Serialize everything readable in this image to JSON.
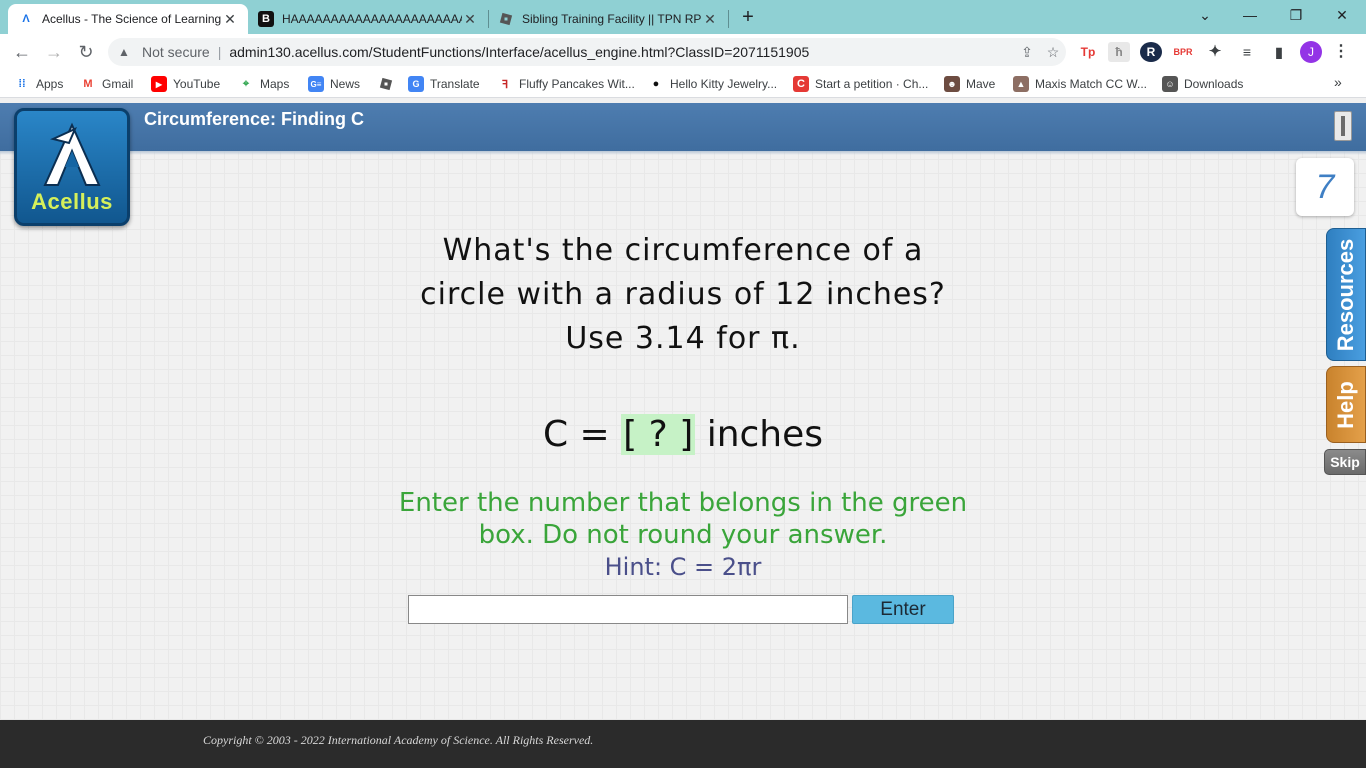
{
  "browser": {
    "tabs": [
      {
        "title": "Acellus - The Science of Learning",
        "favicon": "acellus-icon"
      },
      {
        "title": "HAAAAAAAAAAAAAAAAAAAAAAA",
        "favicon": "b-icon"
      },
      {
        "title": "Sibling Training Facility || TPN RP",
        "favicon": "roblox-icon"
      }
    ],
    "omnibox": {
      "security": "Not secure",
      "url": "admin130.acellus.com/StudentFunctions/Interface/acellus_engine.html?ClassID=2071151905"
    },
    "profile_initial": "J",
    "extensions": [
      "Tp",
      "R",
      "BPR"
    ],
    "bookmarks": [
      {
        "label": "Apps",
        "icon": "apps-grid-icon"
      },
      {
        "label": "Gmail",
        "icon": "gmail-icon"
      },
      {
        "label": "YouTube",
        "icon": "youtube-icon"
      },
      {
        "label": "Maps",
        "icon": "maps-icon"
      },
      {
        "label": "News",
        "icon": "news-icon"
      },
      {
        "label": "",
        "icon": "roblox-icon"
      },
      {
        "label": "Translate",
        "icon": "translate-icon"
      },
      {
        "label": "Fluffy Pancakes Wit...",
        "icon": "recipe-icon"
      },
      {
        "label": "Hello Kitty Jewelry...",
        "icon": "jewelry-icon"
      },
      {
        "label": "Start a petition · Ch...",
        "icon": "change-org-icon"
      },
      {
        "label": "Mave",
        "icon": "avatar-icon"
      },
      {
        "label": "Maxis Match CC W...",
        "icon": "sims-icon"
      },
      {
        "label": "Downloads",
        "icon": "downloads-icon"
      }
    ]
  },
  "app": {
    "header_title": "Circumference: Finding C",
    "logo_text": "Acellus",
    "counter": "7",
    "resources_label": "Resources",
    "help_label": "Help",
    "skip_label": "Skip",
    "colors": {
      "header": "#4e7db0",
      "instruction_green": "#3aa53a",
      "answer_box": "#c6f2c6",
      "enter_button": "#5bb9e0"
    }
  },
  "problem": {
    "question_lines": [
      "What's the circumference of a",
      "circle with a radius of 12 inches?",
      "Use 3.14 for π."
    ],
    "equation_prefix": "C = ",
    "equation_box": "[ ? ]",
    "equation_suffix": " inches",
    "instruction_lines": [
      "Enter the number that belongs in the green",
      "box. Do not round your answer."
    ],
    "hint": "Hint: C = 2πr",
    "answer_value": "",
    "enter_label": "Enter"
  },
  "footer": {
    "copyright": "Copyright © 2003 - 2022 International Academy of Science.  All Rights Reserved."
  }
}
